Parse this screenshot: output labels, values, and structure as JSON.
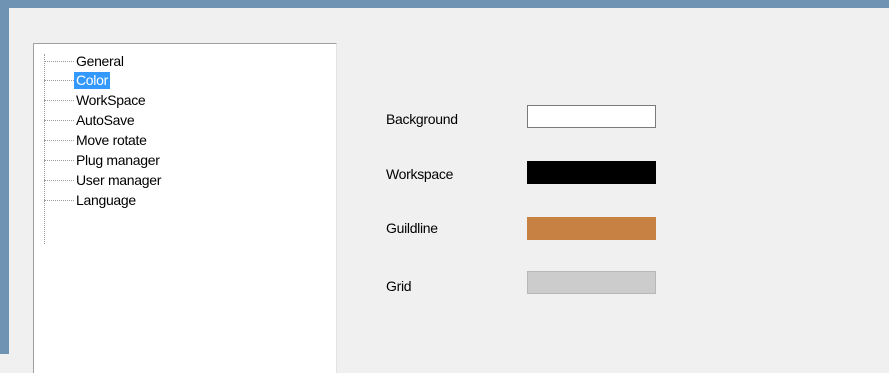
{
  "tree": {
    "items": [
      {
        "label": "General",
        "selected": false
      },
      {
        "label": "Color",
        "selected": true
      },
      {
        "label": "WorkSpace",
        "selected": false
      },
      {
        "label": "AutoSave",
        "selected": false
      },
      {
        "label": "Move rotate",
        "selected": false
      },
      {
        "label": "Plug manager",
        "selected": false
      },
      {
        "label": "User manager",
        "selected": false
      },
      {
        "label": "Language",
        "selected": false
      }
    ]
  },
  "color_settings": {
    "background": {
      "label": "Background",
      "color": "#ffffff"
    },
    "workspace": {
      "label": "Workspace",
      "color": "#000000"
    },
    "guideline": {
      "label": "Guildline",
      "color": "#c68143"
    },
    "grid": {
      "label": "Grid",
      "color": "#cccccc"
    }
  }
}
